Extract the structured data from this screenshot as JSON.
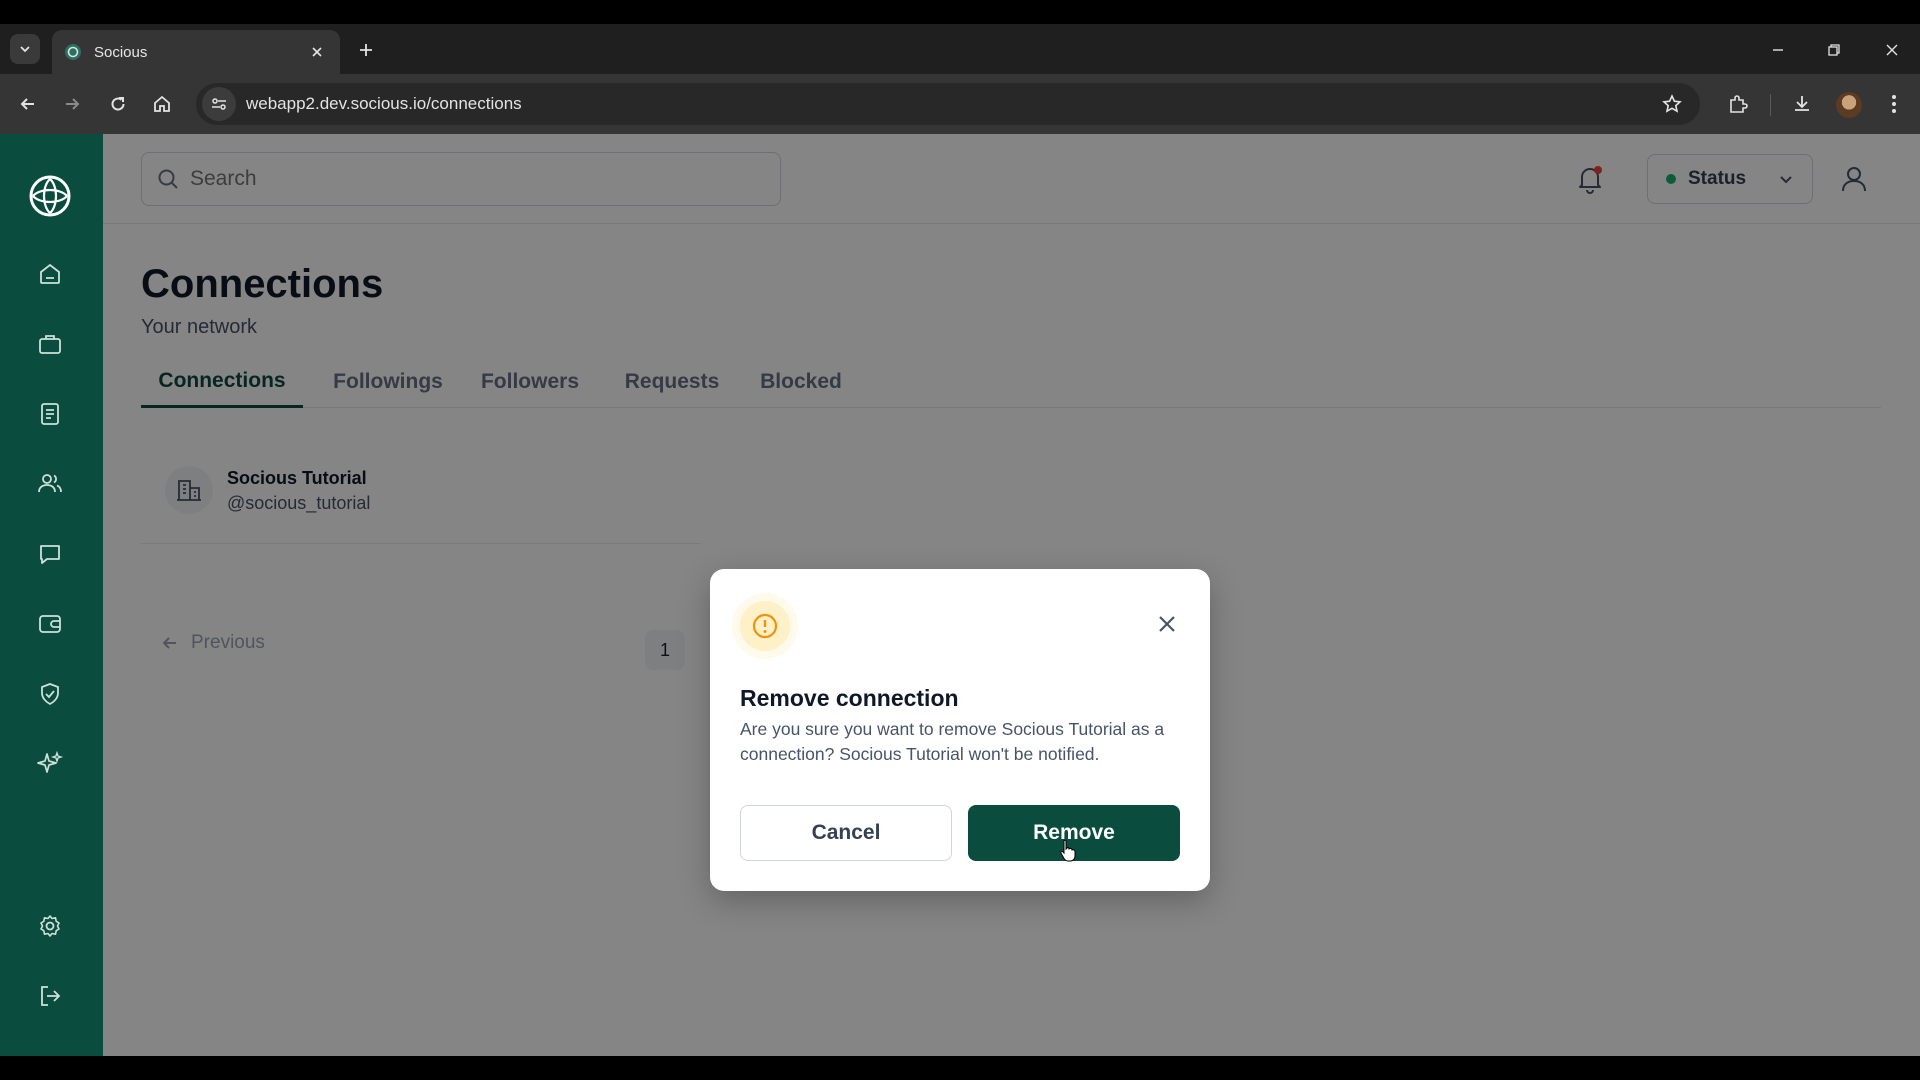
{
  "browser": {
    "tab_title": "Socious",
    "url": "webapp2.dev.socious.io/connections"
  },
  "header": {
    "search_placeholder": "Search",
    "status_label": "Status",
    "status_color": "#17b26a"
  },
  "sidebar": {
    "items": [
      {
        "name": "home",
        "icon": "home-icon"
      },
      {
        "name": "jobs",
        "icon": "briefcase-icon"
      },
      {
        "name": "posts",
        "icon": "document-icon"
      },
      {
        "name": "network",
        "icon": "users-icon"
      },
      {
        "name": "chats",
        "icon": "message-icon"
      },
      {
        "name": "wallet",
        "icon": "wallet-icon"
      },
      {
        "name": "credentials",
        "icon": "shield-check-icon"
      },
      {
        "name": "ai",
        "icon": "sparkles-icon"
      },
      {
        "name": "settings",
        "icon": "gear-icon"
      },
      {
        "name": "logout",
        "icon": "logout-icon"
      }
    ]
  },
  "page": {
    "title": "Connections",
    "subtitle": "Your network",
    "tabs": [
      {
        "label": "Connections",
        "active": true
      },
      {
        "label": "Followings",
        "active": false
      },
      {
        "label": "Followers",
        "active": false
      },
      {
        "label": "Requests",
        "active": false
      },
      {
        "label": "Blocked",
        "active": false
      }
    ]
  },
  "connections": [
    {
      "name": "Socious Tutorial",
      "handle": "@socious_tutorial"
    }
  ],
  "pagination": {
    "previous_label": "Previous",
    "current_page": "1"
  },
  "modal": {
    "title": "Remove connection",
    "body": "Are you sure you want to remove Socious Tutorial as a connection? Socious Tutorial won't be notified.",
    "cancel_label": "Cancel",
    "confirm_label": "Remove",
    "icon": "alert-circle-icon",
    "accent_color": "#0a4c3e",
    "warning_color": "#f79009"
  }
}
